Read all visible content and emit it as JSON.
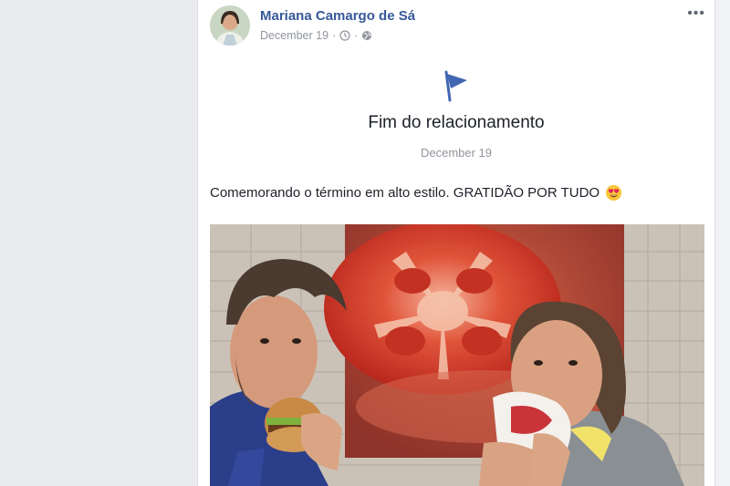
{
  "post": {
    "author": "Mariana Camargo de Sá",
    "date": "December 19",
    "meta_separator": "·",
    "more_label": "•••",
    "event_icon": "flag-icon",
    "event_title": "Fim do relacionamento",
    "event_date": "December 19",
    "text": "Comemorando o término em alto estilo. GRATIDÃO POR TUDO",
    "text_emoji": "heart-eyes-emoji-icon"
  },
  "colors": {
    "author_link": "#365899",
    "meta_gray": "#90949c",
    "flag_blue": "#4267b2",
    "page_background": "#e9ebee"
  }
}
